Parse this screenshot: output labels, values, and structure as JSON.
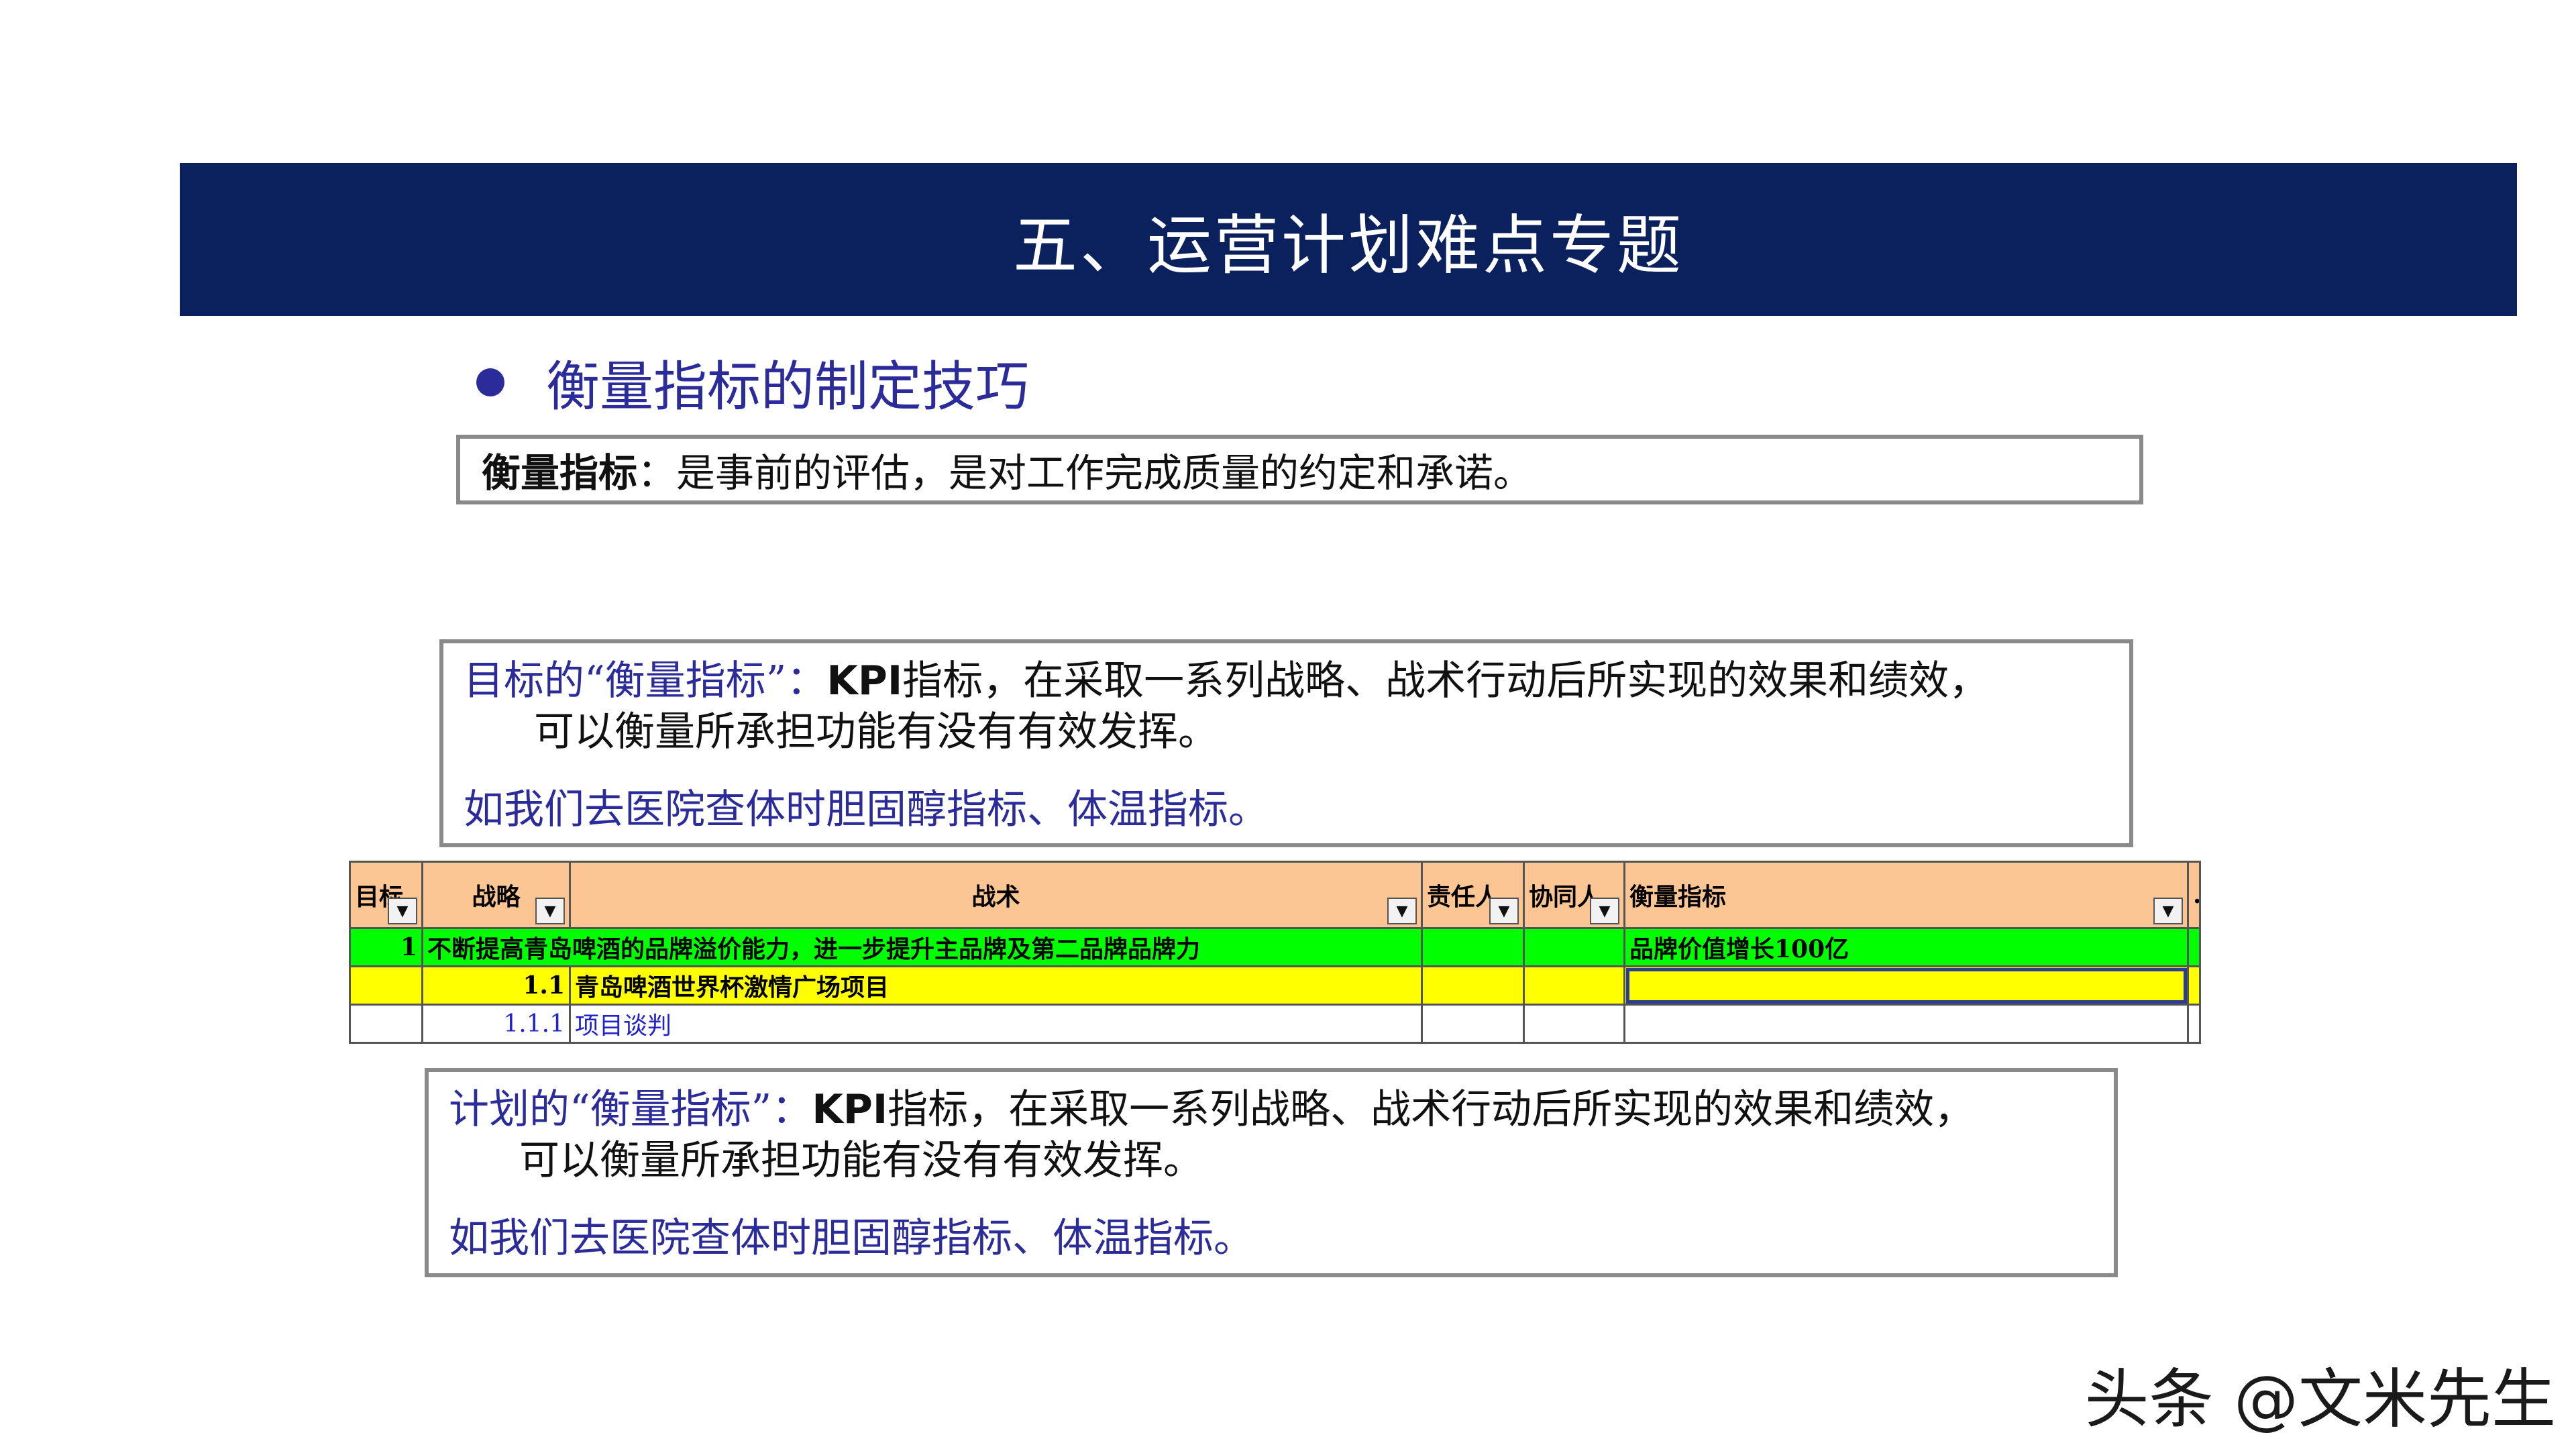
{
  "banner": {
    "title": "五、运营计划难点专题"
  },
  "bullet": {
    "text": "衡量指标的制定技巧"
  },
  "definition": {
    "term": "衡量指标",
    "text": "：是事前的评估，是对工作完成质量的约定和承诺。"
  },
  "goal_quote": {
    "prefix": "目标的“衡量指标”：",
    "kpi": "KPI",
    "line1_rest": "指标，在采取一系列战略、战术行动后所实现的效果和绩效，",
    "line2": "可以衡量所承担功能有没有有效发挥。",
    "line3": "如我们去医院查体时胆固醇指标、体温指标。"
  },
  "plan_quote": {
    "prefix": "计划的“衡量指标”：",
    "kpi": "KPI",
    "line1_rest": "指标，在采取一系列战略、战术行动后所实现的效果和绩效，",
    "line2": "可以衡量所承担功能有没有有效发挥。",
    "line3": "如我们去医院查体时胆固醇指标、体温指标。"
  },
  "sheet": {
    "headers": [
      "目标",
      "战略",
      "战术",
      "责任人",
      "协同人",
      "衡量指标",
      "…"
    ],
    "rows": [
      {
        "num": "1",
        "text": "不断提高青岛啤酒的品牌溢价能力，进一步提升主品牌及第二品牌品牌力",
        "measure": "品牌价值增长100亿"
      },
      {
        "num": "1.1",
        "text": "青岛啤酒世界杯激情广场项目",
        "measure": ""
      },
      {
        "num": "1.1.1",
        "text": "项目谈判",
        "measure": ""
      }
    ],
    "dropdown_glyph": "▼"
  },
  "watermark": {
    "text": "头条 @文米先生"
  }
}
